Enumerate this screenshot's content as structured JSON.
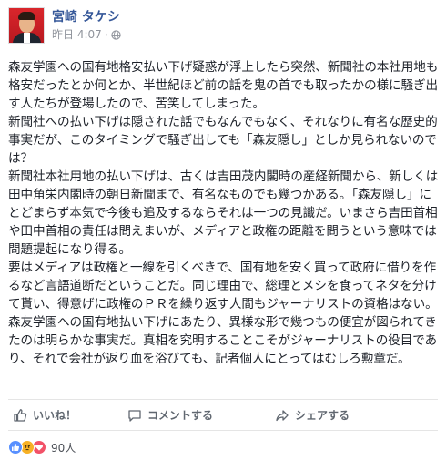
{
  "post": {
    "author": "宮崎 タケシ",
    "time": "昨日 4:07",
    "separator": "·",
    "paragraphs": [
      "森友学園への国有地格安払い下げ疑惑が浮上したら突然、新聞社の本社用地も格安だったとか何とか、半世紀ほど前の話を鬼の首でも取ったかの様に騒ぎ出す人たちが登場したので、苦笑してしまった。",
      "新聞社への払い下げは隠された話でもなんでもなく、それなりに有名な歴史的事実だが、このタイミングで騒ぎ出しても「森友隠し」としか見られないのでは？",
      "新聞社本社用地の払い下げは、古くは吉田茂内閣時の産経新聞から、新しくは田中角栄内閣時の朝日新聞まで、有名なものでも幾つかある。「森友隠し」にとどまらず本気で今後も追及するならそれは一つの見識だ。いまさら吉田首相や田中首相の責任は問えまいが、メディアと政権の距離を問うという意味では問題提起になり得る。",
      "要はメディアは政権と一線を引くべきで、国有地を安く買って政府に借りを作るなど言語道断だということだ。同じ理由で、総理とメシを食ってネタを分けて貰い、得意げに政権のＰＲを繰り返す人間もジャーナリストの資格はない。",
      "森友学園への国有地払い下げにあたり、異様な形で幾つもの便宜が図られてきたのは明らかな事実だ。真相を究明することこそがジャーナリストの役目であり、それで会社が返り血を浴びても、記者個人にとってはむしろ勲章だ。"
    ]
  },
  "actions": {
    "like": "いいね！",
    "comment": "コメントする",
    "share": "シェアする"
  },
  "reactions": {
    "count": "90人"
  }
}
